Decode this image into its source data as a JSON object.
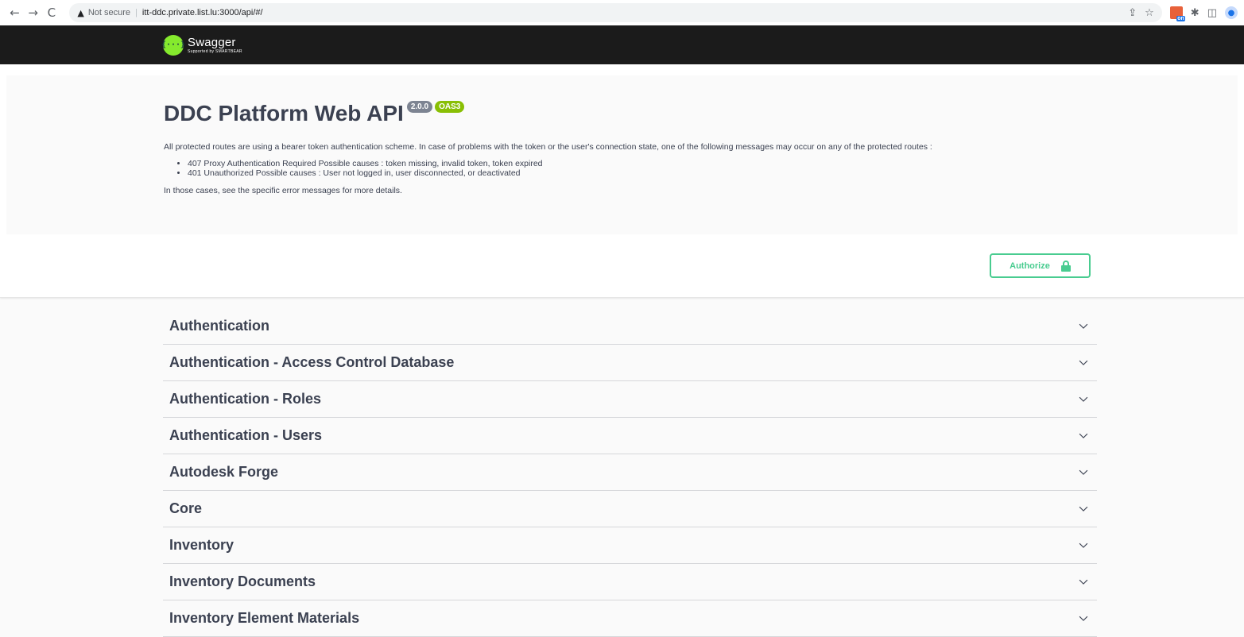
{
  "browser": {
    "back": "←",
    "forward": "→",
    "reload": "C",
    "security_label": "Not secure",
    "url": "itt-ddc.private.list.lu:3000/api/#/",
    "ext_badge_text": "on"
  },
  "topbar": {
    "logo_name": "Swagger",
    "logo_sub": "Supported by SMARTBEAR",
    "logo_glyph": "{···}"
  },
  "info": {
    "title": "DDC Platform Web API",
    "version": "2.0.0",
    "oas": "OAS3",
    "description": "All protected routes are using a bearer token authentication scheme. In case of problems with the token or the user's connection state, one of the following messages may occur on any of the protected routes :",
    "causes": [
      "407 Proxy Authentication Required Possible causes : token missing, invalid token, token expired",
      "401 Unauthorized Possible causes : User not logged in, user disconnected, or deactivated"
    ],
    "footer": "In those cases, see the specific error messages for more details."
  },
  "authorize": {
    "label": "Authorize",
    "accent_color": "#49cc90"
  },
  "tags": [
    {
      "label": "Authentication"
    },
    {
      "label": "Authentication - Access Control Database"
    },
    {
      "label": "Authentication - Roles"
    },
    {
      "label": "Authentication - Users"
    },
    {
      "label": "Autodesk Forge"
    },
    {
      "label": "Core"
    },
    {
      "label": "Inventory"
    },
    {
      "label": "Inventory Documents"
    },
    {
      "label": "Inventory Element Materials"
    }
  ]
}
